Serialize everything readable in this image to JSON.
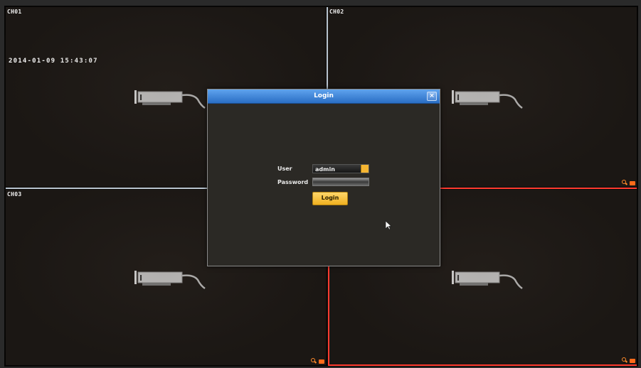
{
  "channels": [
    {
      "id": "ch1",
      "label": "CH01"
    },
    {
      "id": "ch2",
      "label": "CH02"
    },
    {
      "id": "ch3",
      "label": "CH03"
    },
    {
      "id": "ch4",
      "label": ""
    }
  ],
  "overlay": {
    "datetime": "2014-01-09 15:43:07"
  },
  "login_dialog": {
    "title": "Login",
    "close_symbol": "×",
    "user_label": "User",
    "user_value": "admin",
    "password_label": "Password",
    "password_value": "",
    "login_button": "Login"
  },
  "icons": {
    "camera": "camera-placeholder-icon",
    "zoom": "zoom-icon",
    "record": "record-icon",
    "cursor": "mouse-cursor-icon"
  },
  "colors": {
    "divider_normal": "#b9c4cf",
    "divider_active": "#ff3b30",
    "title_bar": "#3d86dc",
    "button_accent": "#f5b532"
  }
}
